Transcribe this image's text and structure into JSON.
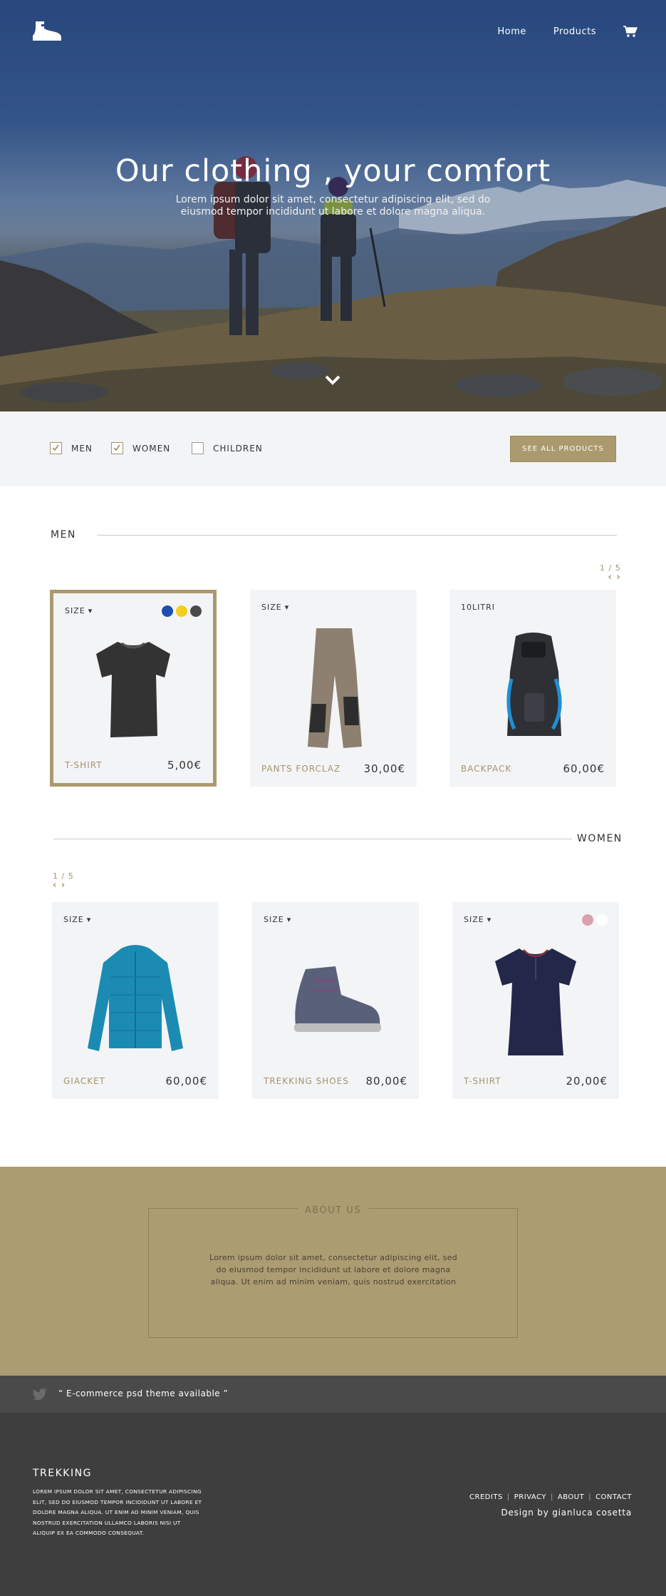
{
  "nav": {
    "home": "Home",
    "products": "Products"
  },
  "hero": {
    "title": "Our clothing , your comfort",
    "subtitle": "Lorem ipsum dolor sit amet, consectetur adipiscing elit, sed do eiusmod tempor incididunt ut labore et dolore magna aliqua."
  },
  "filters": {
    "items": [
      {
        "label": "MEN",
        "checked": true
      },
      {
        "label": "WOMEN",
        "checked": true
      },
      {
        "label": "CHILDREN",
        "checked": false
      }
    ],
    "see_all": "SEE ALL PRODUCTS"
  },
  "men": {
    "title": "MEN",
    "pager": "1 / 5",
    "products": [
      {
        "size": "SIZE",
        "name": "T-SHIRT",
        "price": "5,00€",
        "colors": [
          "#1e4fae",
          "#f2cf1c",
          "#4a4a4a"
        ],
        "selected": true
      },
      {
        "size": "SIZE",
        "name": "PANTS FORCLAZ",
        "price": "30,00€"
      },
      {
        "size": "10LITRI",
        "name": "BACKPACK",
        "price": "60,00€"
      }
    ]
  },
  "women": {
    "title": "WOMEN",
    "pager": "1 / 5",
    "products": [
      {
        "size": "SIZE",
        "name": "GIACKET",
        "price": "60,00€"
      },
      {
        "size": "SIZE",
        "name": "TREKKING SHOES",
        "price": "80,00€"
      },
      {
        "size": "SIZE",
        "name": "T-SHIRT",
        "price": "20,00€",
        "colors": [
          "#d9a0ad",
          "#ffffff"
        ]
      }
    ]
  },
  "about": {
    "title": "ABOUT US",
    "text": "Lorem ipsum dolor sit amet, consectetur adipiscing elit, sed do eiusmod tempor incididunt ut labore et dolore magna aliqua. Ut enim ad minim veniam, quis nostrud exercitation"
  },
  "tweet": {
    "text": "“ E-commerce psd theme available ”"
  },
  "footer": {
    "brand": "TREKKING",
    "text": "Lorem ipsum dolor sit amet, consectetur adipiscing elit, sed do eiusmod tempor incididunt ut labore et dolore magna aliqua. Ut enim ad minim veniam, quis nostrud exercitation ullamco laboris nisi ut aliquip ex ea commodo consequat.",
    "links": [
      "CREDITS",
      "PRIVACY",
      "ABOUT",
      "CONTACT"
    ],
    "credit": "Design by gianluca cosetta"
  },
  "colors": {
    "accent": "#ab9a6e",
    "about_bg": "#ab9c72",
    "footer_bg": "#3e3e3e",
    "tweet_bg": "#4a4a4a",
    "card_bg": "#f3f4f6"
  }
}
